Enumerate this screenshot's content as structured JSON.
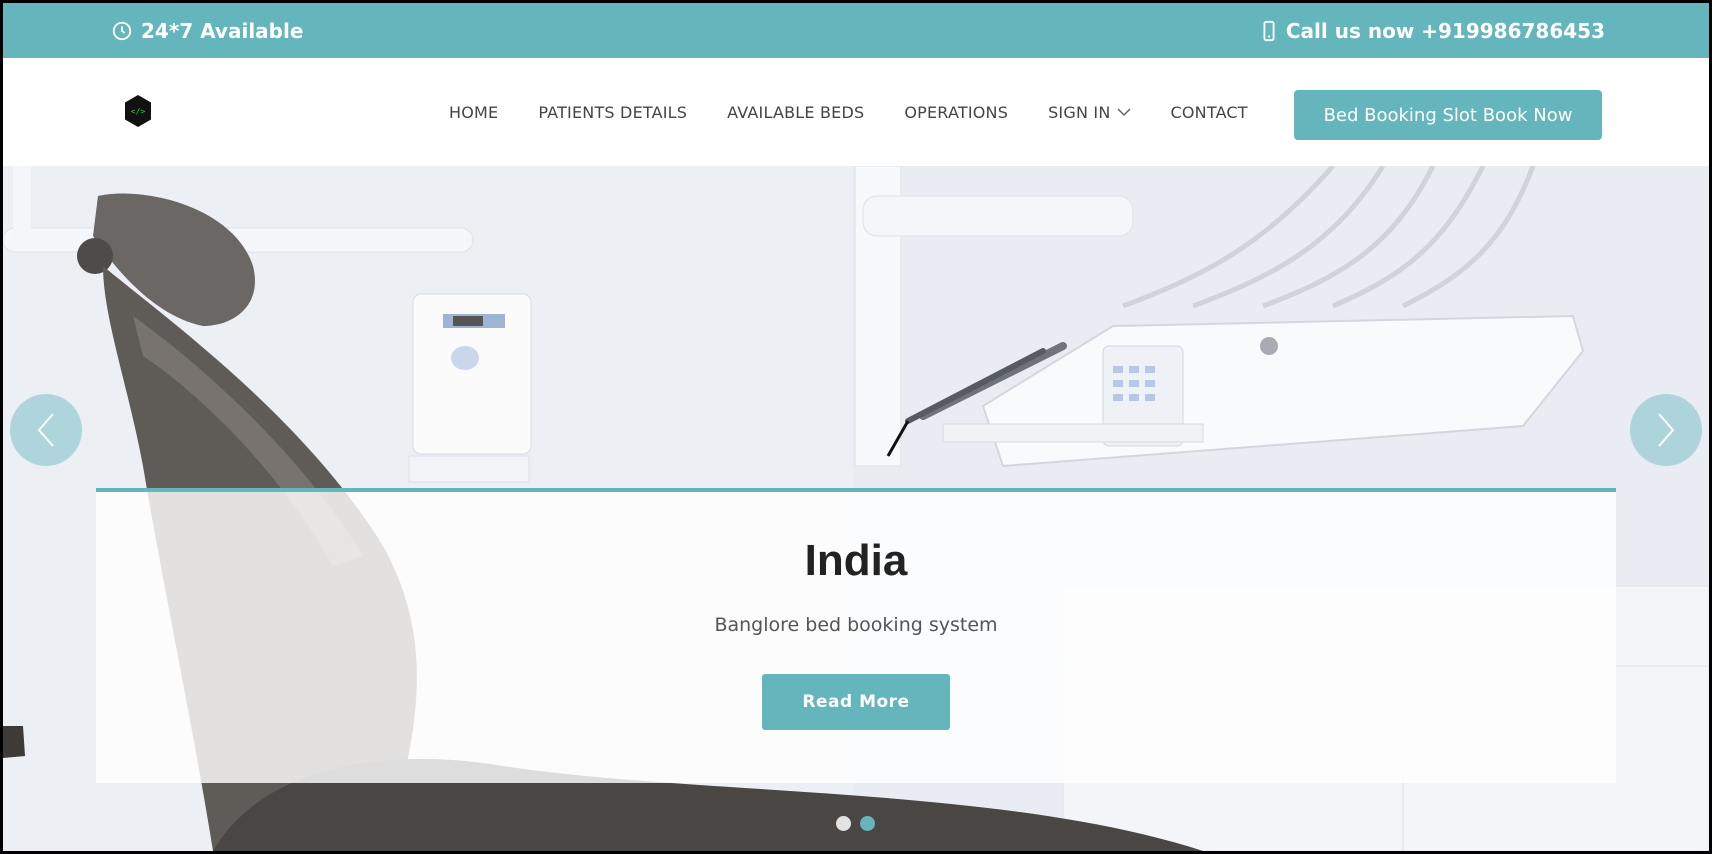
{
  "topbar": {
    "availability": "24*7 Available",
    "phone": "Call us now +919986786453"
  },
  "nav": {
    "items": [
      {
        "label": "HOME"
      },
      {
        "label": "PATIENTS DETAILS"
      },
      {
        "label": "AVAILABLE BEDS"
      },
      {
        "label": "OPERATIONS"
      },
      {
        "label": "SIGN IN"
      },
      {
        "label": "CONTACT"
      }
    ],
    "cta_label": "Bed Booking Slot Book Now"
  },
  "hero": {
    "title": "India",
    "subtitle": "Banglore bed booking system",
    "button_label": "Read More",
    "slide_count": 2,
    "active_slide": 2
  },
  "colors": {
    "accent": "#64b6bc"
  }
}
